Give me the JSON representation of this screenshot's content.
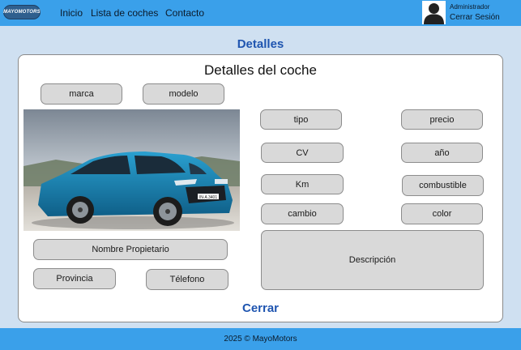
{
  "brand": {
    "logo_text": "MAYOMOTORS",
    "primary_color": "#3aa0ea",
    "heading_color": "#1f55b0"
  },
  "nav": {
    "links": [
      "Inicio",
      "Lista de coches",
      "Contacto"
    ]
  },
  "user": {
    "role": "Administrador",
    "logout_label": "Cerrar Sesión",
    "avatar_icon": "user-icon"
  },
  "page": {
    "heading": "Detalles"
  },
  "card": {
    "title": "Detalles del coche",
    "fields": {
      "marca": "marca",
      "modelo": "modelo",
      "tipo": "tipo",
      "precio": "precio",
      "cv": "CV",
      "anio": "año",
      "km": "Km",
      "combustible": "combustible",
      "cambio": "cambio",
      "color": "color",
      "propietario": "Nombre Propietario",
      "provincia": "Provincia",
      "telefono": "Télefono",
      "descripcion": "Descripción"
    },
    "photo": {
      "plate_text": "IN·A 3401",
      "car_color": "#1d86b9"
    },
    "close_label": "Cerrar"
  },
  "footer": {
    "text": "2025 © MayoMotors"
  }
}
